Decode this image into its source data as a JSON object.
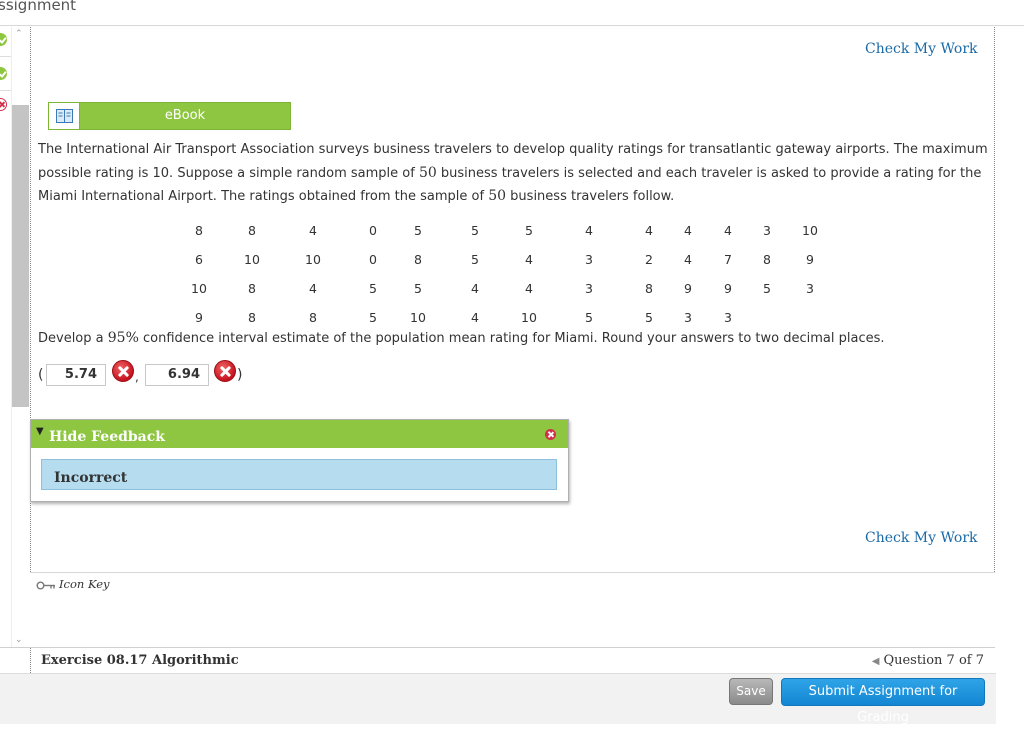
{
  "header": {
    "title": "ssignment"
  },
  "status_icons": [
    "check-green",
    "check-green",
    "x-red"
  ],
  "links": {
    "check_my_work_top": "Check My Work",
    "check_my_work_bottom": "Check My Work"
  },
  "ebook": {
    "label": "eBook"
  },
  "problem": {
    "text_1": "The International Air Transport Association surveys business travelers to develop quality ratings for transatlantic gateway airports. The maximum possible rating is 10. Suppose a simple random sample of ",
    "sample_size_1": "50",
    "text_2": " business travelers is selected and each traveler is asked to provide a rating for the Miami International Airport. The ratings obtained from the sample of ",
    "sample_size_2": "50",
    "text_3": " business travelers follow."
  },
  "ratings_table": [
    [
      "8",
      "8",
      "4",
      "0",
      "5",
      "5",
      "5",
      "4",
      "4",
      "4",
      "4",
      "3",
      "10"
    ],
    [
      "6",
      "10",
      "10",
      "0",
      "8",
      "5",
      "4",
      "3",
      "2",
      "4",
      "7",
      "8",
      "9"
    ],
    [
      "10",
      "8",
      "4",
      "5",
      "5",
      "4",
      "4",
      "3",
      "8",
      "9",
      "9",
      "5",
      "3"
    ],
    [
      "9",
      "8",
      "8",
      "5",
      "10",
      "4",
      "10",
      "5",
      "5",
      "3",
      "3",
      "",
      ""
    ]
  ],
  "instruction": {
    "text_before": "Develop a ",
    "confidence": "95%",
    "text_after": " confidence interval estimate of the population mean rating for Miami. Round your answers to two decimal places."
  },
  "answer": {
    "open_paren": "(",
    "lower": "5.74",
    "comma": ",",
    "upper": "6.94",
    "close_paren": ")"
  },
  "feedback": {
    "title": "Hide Feedback",
    "message": "Incorrect"
  },
  "icon_key": {
    "label": "Icon Key"
  },
  "footer": {
    "exercise_title": "Exercise 08.17 Algorithmic",
    "question_nav": "Question 7 of 7"
  },
  "actions": {
    "save": "Save",
    "submit": "Submit Assignment for Grading"
  },
  "colors": {
    "accent_green": "#8ec641",
    "link_blue": "#1a6aa7",
    "submit_blue": "#1386d3",
    "feedback_blue": "#b6dcef",
    "error_red": "#c6121e"
  }
}
